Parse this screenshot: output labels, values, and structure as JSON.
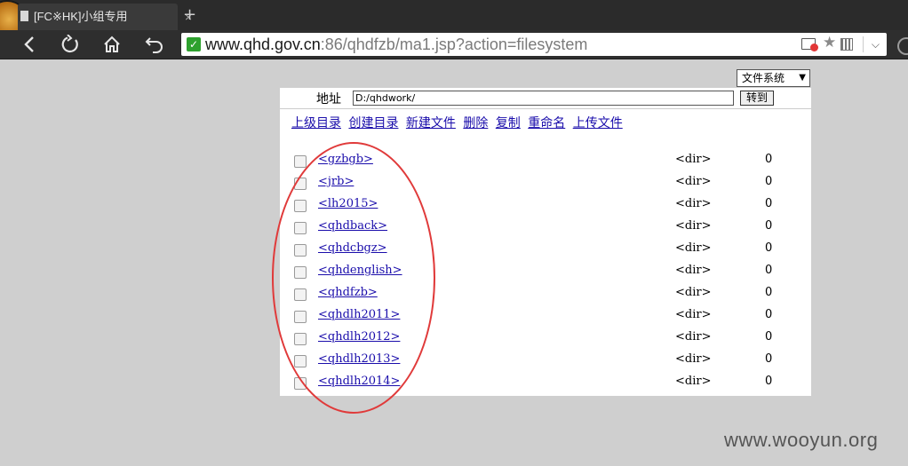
{
  "browser": {
    "tab_title": "[FC※HK]小组专用",
    "tab_close": "×",
    "new_tab": "+",
    "url_host": "www.qhd.gov.cn",
    "url_rest": ":86/qhdfzb/ma1.jsp?action=filesystem",
    "nav_icons": [
      "back-icon",
      "reload-icon",
      "home-icon",
      "undo-icon"
    ]
  },
  "page": {
    "fs_select": "文件系统",
    "address_label": "地址",
    "path_value": "D:/qhdwork/",
    "go_button": "转到",
    "actions": [
      "上级目录",
      "创建目录",
      "新建文件",
      "删除",
      "复制",
      "重命名",
      "上传文件"
    ],
    "entries": [
      {
        "name": "<gzbgb>",
        "type": "<dir>",
        "size": "0"
      },
      {
        "name": "<jrb>",
        "type": "<dir>",
        "size": "0"
      },
      {
        "name": "<lh2015>",
        "type": "<dir>",
        "size": "0"
      },
      {
        "name": "<qhdback>",
        "type": "<dir>",
        "size": "0"
      },
      {
        "name": "<qhdcbgz>",
        "type": "<dir>",
        "size": "0"
      },
      {
        "name": "<qhdenglish>",
        "type": "<dir>",
        "size": "0"
      },
      {
        "name": "<qhdfzb>",
        "type": "<dir>",
        "size": "0"
      },
      {
        "name": "<qhdlh2011>",
        "type": "<dir>",
        "size": "0"
      },
      {
        "name": "<qhdlh2012>",
        "type": "<dir>",
        "size": "0"
      },
      {
        "name": "<qhdlh2013>",
        "type": "<dir>",
        "size": "0"
      },
      {
        "name": "<qhdlh2014>",
        "type": "<dir>",
        "size": "0"
      }
    ],
    "annotation_color": "#e03a3a"
  },
  "watermark": "www.wooyun.org"
}
